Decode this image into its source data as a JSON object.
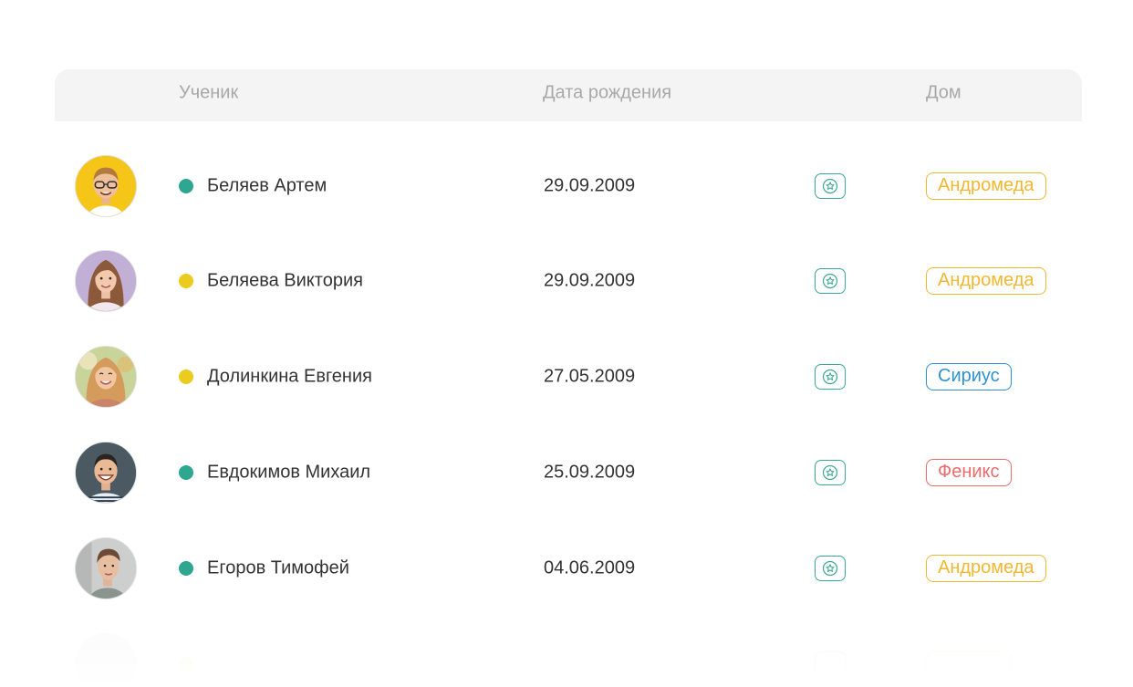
{
  "header": {
    "student": "Ученик",
    "birth_date": "Дата рождения",
    "house": "Дом"
  },
  "colors": {
    "status_green": "#2ea690",
    "status_yellow": "#eccb1f",
    "star_border": "#3aa88f",
    "house_andromeda": "#f1b731",
    "house_sirius": "#2f92cf",
    "house_phoenix": "#e96d6d"
  },
  "rows": [
    {
      "name": "Беляев Артем",
      "birth": "29.09.2009",
      "status": "green",
      "house": "Андромеда",
      "house_key": "andromeda"
    },
    {
      "name": "Беляева Виктория",
      "birth": "29.09.2009",
      "status": "yellow",
      "house": "Андромеда",
      "house_key": "andromeda"
    },
    {
      "name": "Долинкина Евгения",
      "birth": "27.05.2009",
      "status": "yellow",
      "house": "Сириус",
      "house_key": "sirius"
    },
    {
      "name": "Евдокимов Михаил",
      "birth": "25.09.2009",
      "status": "green",
      "house": "Феникс",
      "house_key": "phoenix"
    },
    {
      "name": "Егоров Тимофей",
      "birth": "04.06.2009",
      "status": "green",
      "house": "Андромеда",
      "house_key": "andromeda"
    }
  ],
  "icons": {
    "star": "star-icon",
    "avatar": "avatar"
  }
}
